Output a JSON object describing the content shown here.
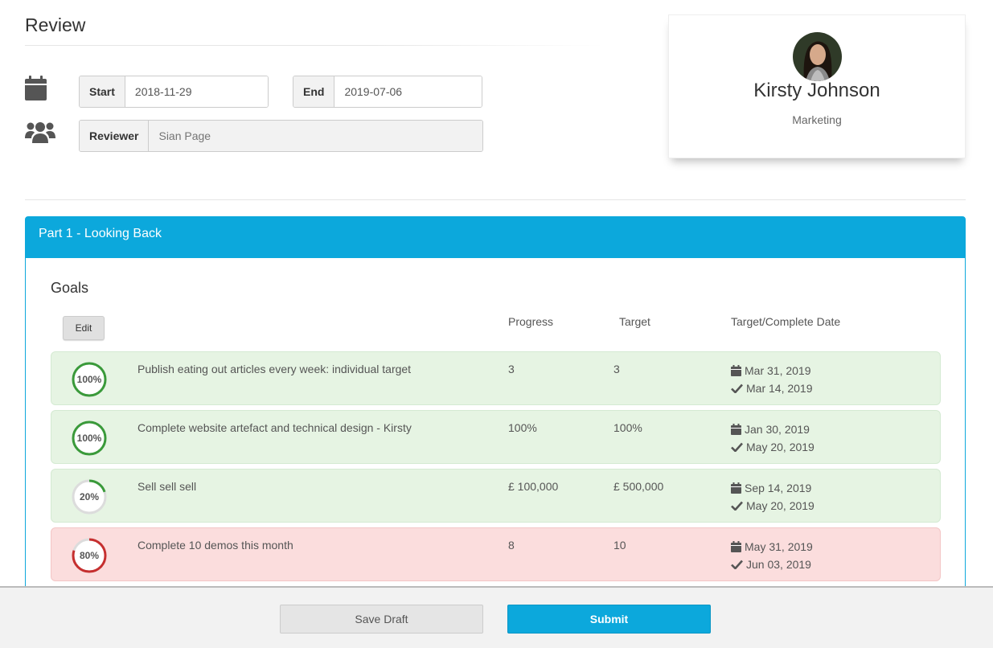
{
  "header": {
    "title": "Review"
  },
  "dates": {
    "start_label": "Start",
    "start_value": "2018-11-29",
    "end_label": "End",
    "end_value": "2019-07-06",
    "reviewer_label": "Reviewer",
    "reviewer_placeholder": "Sian Page"
  },
  "profile": {
    "name": "Kirsty Johnson",
    "department": "Marketing"
  },
  "panel": {
    "title": "Part 1 - Looking Back",
    "goals_title": "Goals",
    "edit_label": "Edit",
    "columns": {
      "progress": "Progress",
      "target": "Target",
      "date": "Target/Complete Date"
    },
    "goals": [
      {
        "percent_label": "100%",
        "percent": 1.0,
        "status": "complete",
        "ring_color": "#3a9a3a",
        "name": "Publish eating out articles every week: individual target",
        "progress": "3",
        "target": "3",
        "target_date": "Mar 31, 2019",
        "complete_date": "Mar 14, 2019"
      },
      {
        "percent_label": "100%",
        "percent": 1.0,
        "status": "complete",
        "ring_color": "#3a9a3a",
        "name": "Complete website artefact and technical design - Kirsty",
        "progress": "100%",
        "target": "100%",
        "target_date": "Jan 30, 2019",
        "complete_date": "May 20, 2019"
      },
      {
        "percent_label": "20%",
        "percent": 0.2,
        "status": "complete",
        "ring_color": "#3a9a3a",
        "name": "Sell sell sell",
        "progress": "£ 100,000",
        "target": "£ 500,000",
        "target_date": "Sep 14, 2019",
        "complete_date": "May 20, 2019"
      },
      {
        "percent_label": "80%",
        "percent": 0.8,
        "status": "late",
        "ring_color": "#c62f2f",
        "name": "Complete 10 demos this month",
        "progress": "8",
        "target": "10",
        "target_date": "May 31, 2019",
        "complete_date": "Jun 03, 2019"
      }
    ]
  },
  "footer": {
    "save_label": "Save Draft",
    "submit_label": "Submit"
  },
  "colors": {
    "accent": "#0ca8dc",
    "good_bg": "#e6f4e3",
    "bad_bg": "#fbdddd"
  },
  "icons": {
    "dates": "calendar-icon",
    "reviewer": "users-icon",
    "target_date": "calendar-icon",
    "complete_date": "check-icon"
  }
}
